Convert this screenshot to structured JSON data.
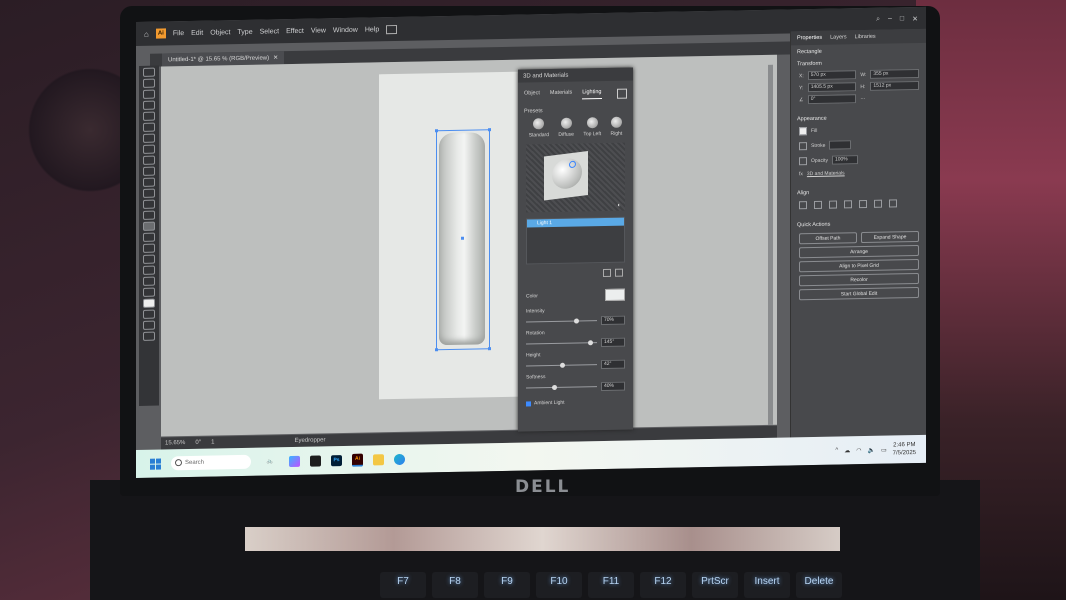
{
  "menu": {
    "app_icon": "Ai",
    "items": [
      "File",
      "Edit",
      "Object",
      "Type",
      "Select",
      "Effect",
      "View",
      "Window",
      "Help"
    ]
  },
  "document": {
    "tab_title": "Untitled-1* @ 15.65 % (RGB/Preview)"
  },
  "status_bar": {
    "zoom": "15.65%",
    "rotation": "0°",
    "artboard": "1",
    "tool": "Eyedropper"
  },
  "panel_3d": {
    "title": "3D and Materials",
    "tabs": [
      "Object",
      "Materials",
      "Lighting"
    ],
    "active_tab": "Lighting",
    "presets_label": "Presets",
    "presets": [
      "Standard",
      "Diffuse",
      "Top Left",
      "Right"
    ],
    "light_name": "Light 1",
    "color_label": "Color",
    "sliders": [
      {
        "label": "Intensity",
        "value": "70%",
        "level": 0.7
      },
      {
        "label": "Rotation",
        "value": "145°",
        "level": 0.9
      },
      {
        "label": "Height",
        "value": "42°",
        "level": 0.5
      },
      {
        "label": "Softness",
        "value": "40%",
        "level": 0.4
      }
    ],
    "ambient_label": "Ambient Light"
  },
  "properties": {
    "tabs": [
      "Properties",
      "Layers",
      "Libraries"
    ],
    "selection_type": "Rectangle",
    "transform_label": "Transform",
    "x_label": "X:",
    "x_value": "570 px",
    "y_label": "Y:",
    "y_value": "1405.5 px",
    "w_label": "W:",
    "w_value": "355 px",
    "h_label": "H:",
    "h_value": "1512 px",
    "angle_value": "0°",
    "appearance_label": "Appearance",
    "fill_label": "Fill",
    "stroke_label": "Stroke",
    "opacity_label": "Opacity",
    "opacity_value": "100%",
    "effect_label": "3D and Materials",
    "align_label": "Align",
    "quick_actions_label": "Quick Actions",
    "actions": {
      "offset_path": "Offset Path",
      "expand_shape": "Expand Shape",
      "arrange": "Arrange",
      "align_pixel": "Align to Pixel Grid",
      "recolor": "Recolor",
      "global_edit": "Start Global Edit"
    }
  },
  "taskbar": {
    "search_placeholder": "Search",
    "time": "2:46 PM",
    "date": "7/5/2025"
  },
  "laptop": {
    "brand": "DELL",
    "keys": [
      "F7",
      "F8",
      "F9",
      "F10",
      "F11",
      "F12",
      "PrtScr",
      "Insert",
      "Delete"
    ]
  },
  "colors": {
    "accent": "#4c8ef0",
    "illustrator_orange": "#f29a2f"
  }
}
